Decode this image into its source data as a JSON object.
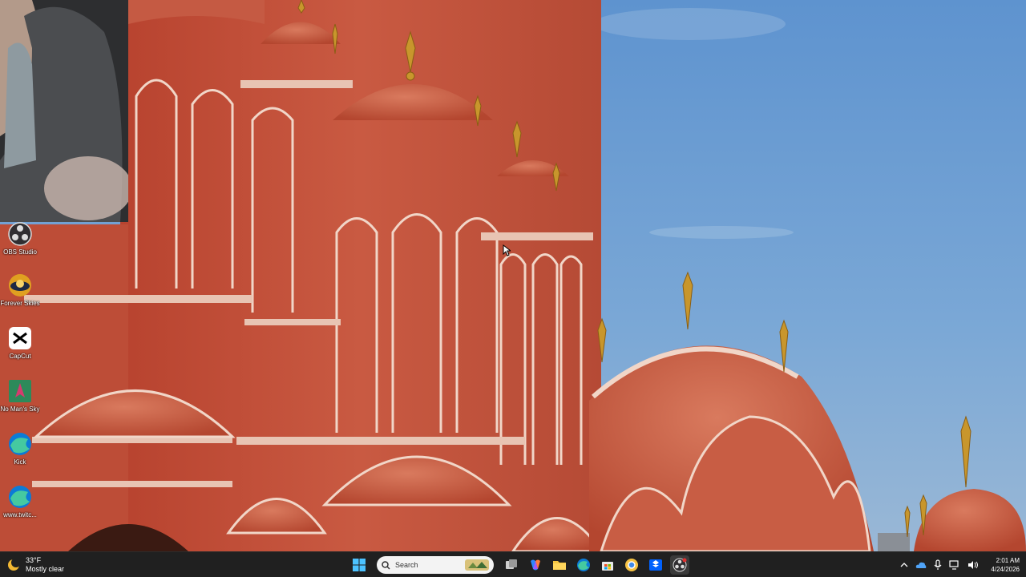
{
  "desktop": {
    "icons": [
      {
        "label": "OBS Studio",
        "icon": "obs-icon"
      },
      {
        "label": "Forever Skies",
        "icon": "forever-skies-icon"
      },
      {
        "label": "CapCut",
        "icon": "capcut-icon"
      },
      {
        "label": "No Man's Sky",
        "icon": "no-mans-sky-icon"
      },
      {
        "label": "Kick",
        "icon": "edge-kick-icon"
      },
      {
        "label": "www.twitc...",
        "icon": "edge-twitch-icon"
      }
    ]
  },
  "taskbar": {
    "weather": {
      "temp": "33°F",
      "condition": "Mostly clear"
    },
    "search": {
      "placeholder": "Search"
    },
    "apps": [
      "start-icon",
      "search",
      "task-view-icon",
      "copilot-icon",
      "file-explorer-icon",
      "edge-icon",
      "store-icon",
      "chrome-canary-icon",
      "dropbox-icon",
      "obs-taskbar-icon"
    ],
    "clock": {
      "time": "2:01 AM",
      "date": "4/24/2026"
    }
  },
  "colors": {
    "sky": "#6b9bd0",
    "sandstone": "#c4553f",
    "taskbar": "#202020",
    "accent": "#0078d4"
  }
}
